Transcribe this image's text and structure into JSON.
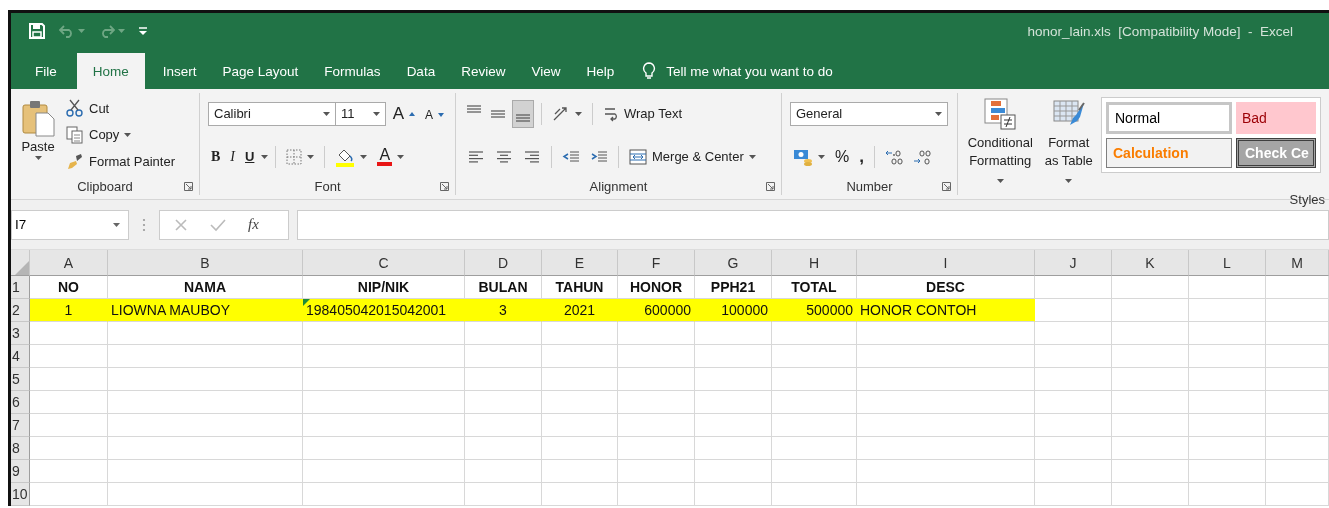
{
  "window": {
    "title": "honor_lain.xls  [Compatibility Mode]  -  Excel"
  },
  "quick_access": [
    {
      "kind": "save",
      "disabled": false
    },
    {
      "kind": "undo",
      "disabled": true
    },
    {
      "kind": "redo",
      "disabled": true
    },
    {
      "kind": "customize",
      "disabled": false
    }
  ],
  "tabs": [
    {
      "label": "File",
      "selected": false
    },
    {
      "label": "Home",
      "selected": true
    },
    {
      "label": "Insert",
      "selected": false
    },
    {
      "label": "Page Layout",
      "selected": false
    },
    {
      "label": "Formulas",
      "selected": false
    },
    {
      "label": "Data",
      "selected": false
    },
    {
      "label": "Review",
      "selected": false
    },
    {
      "label": "View",
      "selected": false
    },
    {
      "label": "Help",
      "selected": false
    }
  ],
  "tell_me": {
    "placeholder": "Tell me what you want to do"
  },
  "ribbon": {
    "clipboard": {
      "label": "Clipboard",
      "paste": "Paste",
      "cut": "Cut",
      "copy": "Copy",
      "format_painter": "Format Painter"
    },
    "font": {
      "label": "Font",
      "font_name": "Calibri",
      "font_size": "11",
      "grow": "A",
      "shrink": "A",
      "bold": "B",
      "italic": "I",
      "underline": "U",
      "font_color": "A"
    },
    "alignment": {
      "label": "Alignment",
      "vertical_align": [
        {
          "selected": false
        },
        {
          "selected": false
        },
        {
          "selected": true
        }
      ],
      "wrap_text": "Wrap Text",
      "merge_center": "Merge & Center"
    },
    "number": {
      "label": "Number",
      "format": "General",
      "percent": "%",
      "comma": ","
    },
    "styles": {
      "label": "Styles",
      "conditional_formatting": "Conditional Formatting",
      "format_as_table": "Format as Table",
      "gallery": [
        {
          "kind": "normal",
          "label": "Normal"
        },
        {
          "kind": "bad",
          "label": "Bad"
        },
        {
          "kind": "calculation",
          "label": "Calculation"
        },
        {
          "kind": "check",
          "label": "Check Ce"
        }
      ]
    }
  },
  "formula_bar": {
    "name_box": "I7",
    "function_label": "fx"
  },
  "sheet": {
    "columns": [
      "A",
      "B",
      "C",
      "D",
      "E",
      "F",
      "G",
      "H",
      "I",
      "J",
      "K",
      "L",
      "M"
    ],
    "rows": [
      {
        "number": "1",
        "kind": "header",
        "highlighted": false,
        "cells": [
          {
            "text": "NO"
          },
          {
            "text": "NAMA"
          },
          {
            "text": "NIP/NIK"
          },
          {
            "text": "BULAN"
          },
          {
            "text": "TAHUN"
          },
          {
            "text": "HONOR"
          },
          {
            "text": "PPH21"
          },
          {
            "text": "TOTAL"
          },
          {
            "text": "DESC"
          }
        ]
      },
      {
        "number": "2",
        "kind": "data",
        "highlighted": true,
        "cells": [
          {
            "text": "1"
          },
          {
            "text": "LIOWNA MAUBOY"
          },
          {
            "text": "198405042015042001",
            "error_flag": true
          },
          {
            "text": "3"
          },
          {
            "text": "2021"
          },
          {
            "text": "600000"
          },
          {
            "text": "100000"
          },
          {
            "text": "500000"
          },
          {
            "text": "HONOR CONTOH"
          }
        ]
      },
      {
        "number": "3",
        "kind": "data",
        "highlighted": false
      },
      {
        "number": "4",
        "kind": "data",
        "highlighted": false
      },
      {
        "number": "5",
        "kind": "data",
        "highlighted": false
      },
      {
        "number": "6",
        "kind": "data",
        "highlighted": false
      },
      {
        "number": "7",
        "kind": "data",
        "highlighted": false
      },
      {
        "number": "8",
        "kind": "data",
        "highlighted": false
      },
      {
        "number": "9",
        "kind": "data",
        "highlighted": false
      },
      {
        "number": "10",
        "kind": "data",
        "highlighted": false
      }
    ]
  }
}
